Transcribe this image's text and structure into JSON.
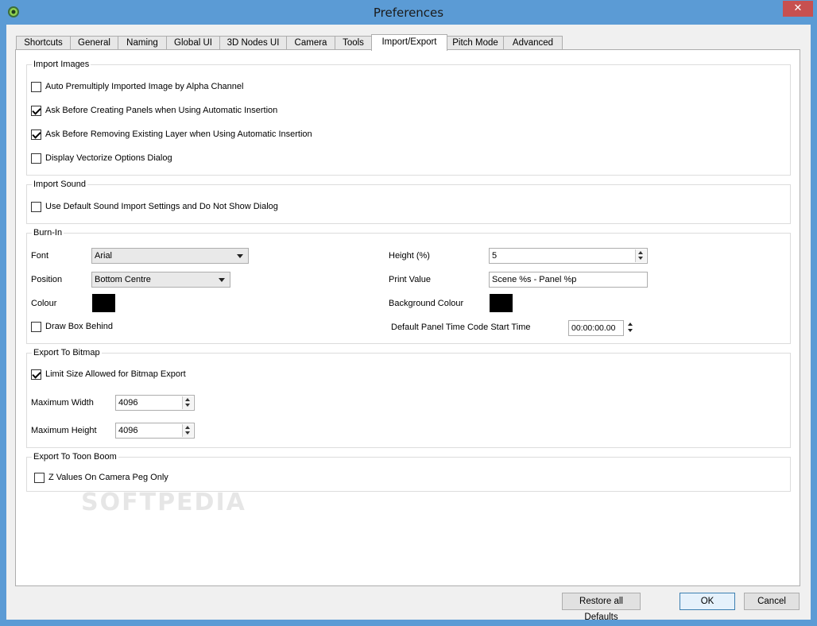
{
  "window": {
    "title": "Preferences",
    "close_glyph": "✕",
    "app_icon": "toonboom-logo-icon"
  },
  "tabs": [
    {
      "label": "Shortcuts"
    },
    {
      "label": "General"
    },
    {
      "label": "Naming"
    },
    {
      "label": "Global UI"
    },
    {
      "label": "3D Nodes UI"
    },
    {
      "label": "Camera"
    },
    {
      "label": "Tools"
    },
    {
      "label": "Import/Export",
      "active": true
    },
    {
      "label": "Pitch Mode"
    },
    {
      "label": "Advanced"
    }
  ],
  "import_images": {
    "title": "Import Images",
    "options": [
      {
        "label": "Auto Premultiply Imported Image by Alpha Channel",
        "checked": false
      },
      {
        "label": "Ask Before Creating Panels when Using Automatic Insertion",
        "checked": true
      },
      {
        "label": "Ask Before Removing Existing Layer when Using Automatic Insertion",
        "checked": true
      },
      {
        "label": "Display Vectorize Options Dialog",
        "checked": false
      }
    ]
  },
  "import_sound": {
    "title": "Import Sound",
    "options": [
      {
        "label": "Use Default Sound Import Settings and Do Not Show Dialog",
        "checked": false
      }
    ]
  },
  "burn_in": {
    "title": "Burn-In",
    "font_label": "Font",
    "font_value": "Arial",
    "position_label": "Position",
    "position_value": "Bottom Centre",
    "colour_label": "Colour",
    "colour": "#000000",
    "draw_box_label": "Draw Box Behind",
    "draw_box_checked": false,
    "height_label": "Height (%)",
    "height_value": "5",
    "print_value_label": "Print Value",
    "print_value": "Scene %s - Panel %p",
    "background_colour_label": "Background Colour",
    "background_colour": "#000000",
    "timecode_label": "Default Panel Time Code Start Time",
    "timecode_value": "00:00:00.00"
  },
  "export_bitmap": {
    "title": "Export To Bitmap",
    "limit_label": "Limit Size Allowed for Bitmap Export",
    "limit_checked": true,
    "max_width_label": "Maximum Width",
    "max_width_value": "4096",
    "max_height_label": "Maximum Height",
    "max_height_value": "4096"
  },
  "export_toonboom": {
    "title": "Export To Toon Boom",
    "z_values_label": "Z Values On Camera Peg Only",
    "z_values_checked": false
  },
  "watermark": "SOFTPEDIA",
  "buttons": {
    "restore": "Restore all Defaults",
    "ok": "OK",
    "cancel": "Cancel"
  }
}
